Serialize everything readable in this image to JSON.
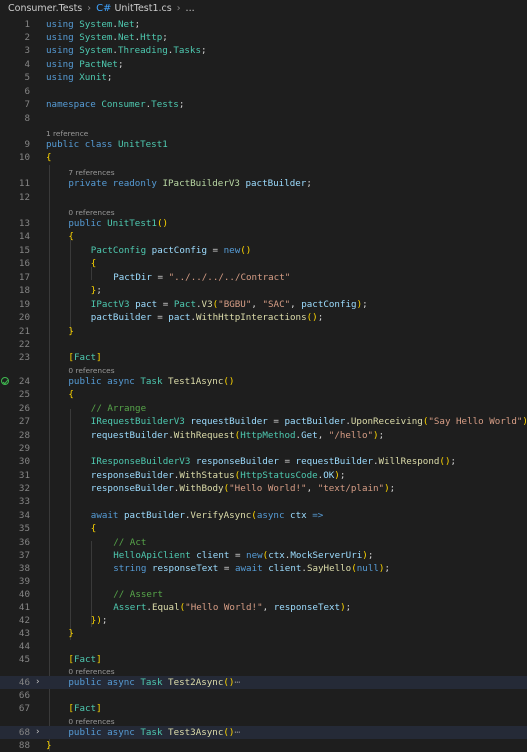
{
  "breadcrumb": {
    "project": "Consumer.Tests",
    "file": "UnitTest1.cs",
    "more": "..."
  },
  "code_lens": {
    "r1": "1 reference",
    "r7": "7 references",
    "r0": "0 references"
  },
  "lines": [
    {
      "n": "1",
      "t": "using System.Net;"
    },
    {
      "n": "2",
      "t": "using System.Net.Http;"
    },
    {
      "n": "3",
      "t": "using System.Threading.Tasks;"
    },
    {
      "n": "4",
      "t": "using PactNet;"
    },
    {
      "n": "5",
      "t": "using Xunit;"
    },
    {
      "n": "6",
      "t": ""
    },
    {
      "n": "7",
      "t": "namespace Consumer.Tests;"
    },
    {
      "n": "8",
      "t": ""
    },
    {
      "n": "9",
      "t": "public class UnitTest1"
    },
    {
      "n": "10",
      "t": "{"
    },
    {
      "n": "11",
      "t": "private readonly IPactBuilderV3 pactBuilder;"
    },
    {
      "n": "12",
      "t": ""
    },
    {
      "n": "13",
      "t": "public UnitTest1()"
    },
    {
      "n": "14",
      "t": "{"
    },
    {
      "n": "15",
      "t": "PactConfig pactConfig = new()"
    },
    {
      "n": "16",
      "t": "{"
    },
    {
      "n": "17",
      "t": "PactDir = \"../../../../Contract\""
    },
    {
      "n": "18",
      "t": "};"
    },
    {
      "n": "19",
      "t": "IPactV3 pact = Pact.V3(\"BGBU\", \"SAC\", pactConfig);"
    },
    {
      "n": "20",
      "t": "pactBuilder = pact.WithHttpInteractions();"
    },
    {
      "n": "21",
      "t": "}"
    },
    {
      "n": "22",
      "t": ""
    },
    {
      "n": "23",
      "t": "[Fact]"
    },
    {
      "n": "24",
      "t": "public async Task Test1Async()"
    },
    {
      "n": "25",
      "t": "{"
    },
    {
      "n": "26",
      "t": "// Arrange"
    },
    {
      "n": "27",
      "t": "IRequestBuilderV3 requestBuilder = pactBuilder.UponReceiving(\"Say Hello World\");"
    },
    {
      "n": "28",
      "t": "requestBuilder.WithRequest(HttpMethod.Get, \"/hello\");"
    },
    {
      "n": "29",
      "t": ""
    },
    {
      "n": "30",
      "t": "IResponseBuilderV3 responseBuilder = requestBuilder.WillRespond();"
    },
    {
      "n": "31",
      "t": "responseBuilder.WithStatus(HttpStatusCode.OK);"
    },
    {
      "n": "32",
      "t": "responseBuilder.WithBody(\"Hello World!\", \"text/plain\");"
    },
    {
      "n": "33",
      "t": ""
    },
    {
      "n": "34",
      "t": "await pactBuilder.VerifyAsync(async ctx =>"
    },
    {
      "n": "35",
      "t": "{"
    },
    {
      "n": "36",
      "t": "// Act"
    },
    {
      "n": "37",
      "t": "HelloApiClient client = new(ctx.MockServerUri);"
    },
    {
      "n": "38",
      "t": "string responseText = await client.SayHello(null);"
    },
    {
      "n": "39",
      "t": ""
    },
    {
      "n": "40",
      "t": "// Assert"
    },
    {
      "n": "41",
      "t": "Assert.Equal(\"Hello World!\", responseText);"
    },
    {
      "n": "42",
      "t": "});"
    },
    {
      "n": "43",
      "t": "}"
    },
    {
      "n": "44",
      "t": ""
    },
    {
      "n": "45",
      "t": "[Fact]"
    },
    {
      "n": "46",
      "t": "public async Task Test2Async()"
    },
    {
      "n": "66",
      "t": ""
    },
    {
      "n": "67",
      "t": "[Fact]"
    },
    {
      "n": "68",
      "t": "public async Task Test3Async()"
    },
    {
      "n": "88",
      "t": "}"
    }
  ],
  "fold_ellipsis": "⋯",
  "colors": {
    "background": "#1e1e1e",
    "keyword": "#569cd6",
    "type": "#4ec9b0",
    "method": "#dcdcaa",
    "string": "#d69d85",
    "comment": "#57a64a",
    "test_passed": "#3fb950"
  },
  "icons": {
    "file_icon": "csharp-file-icon",
    "test_status": "test-passed-icon",
    "fold": "chevron-right-icon"
  }
}
